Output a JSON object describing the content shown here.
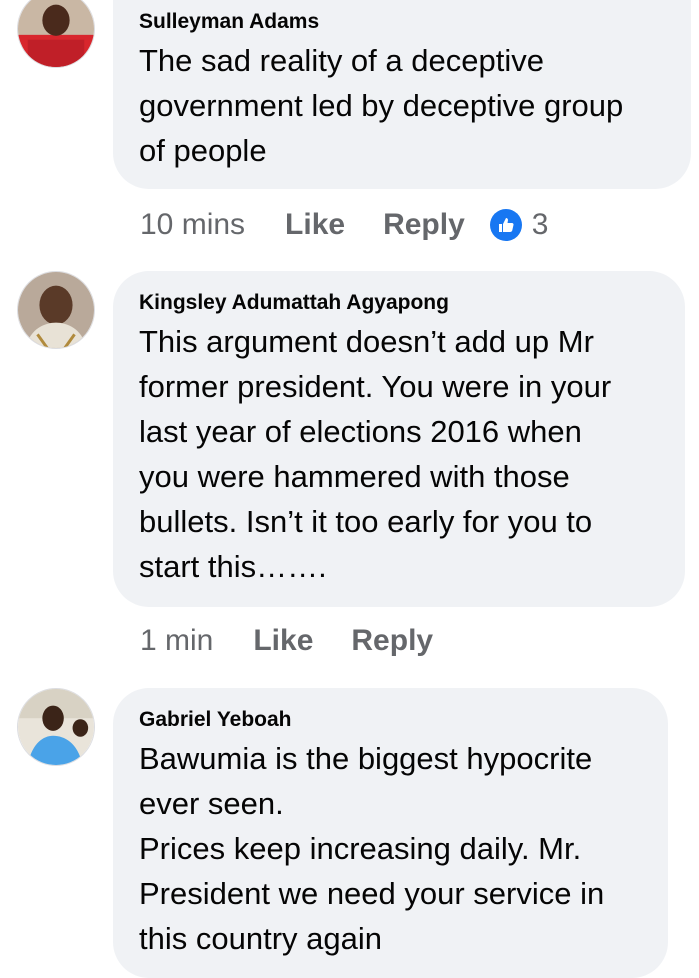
{
  "comments": [
    {
      "author": "Sulleyman Adams",
      "text": "The sad reality of a deceptive\ngovernment led by deceptive group\nof people",
      "time": "10 mins",
      "like_label": "Like",
      "reply_label": "Reply",
      "reaction_icon": "thumbs-up-icon",
      "reaction_count": "3"
    },
    {
      "author": "Kingsley Adumattah Agyapong",
      "text": "This argument doesn’t add up Mr\nformer president. You were in your\nlast year of elections 2016 when\nyou were hammered with those\nbullets. Isn’t it too early for you to\nstart this…….",
      "time": "1 min",
      "like_label": "Like",
      "reply_label": "Reply"
    },
    {
      "author": "Gabriel Yeboah",
      "text": "Bawumia is the biggest hypocrite\never seen.\nPrices keep increasing daily. Mr.\nPresident we need your service in\nthis country again"
    }
  ],
  "colors": {
    "bubble": "#f0f2f5",
    "meta_text": "#65676b",
    "like_blue": "#1877f2"
  }
}
